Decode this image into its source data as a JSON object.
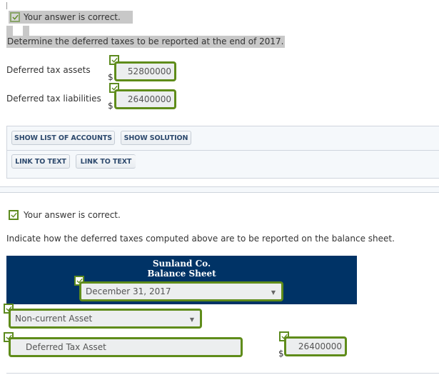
{
  "part1": {
    "correct_message": "Your answer is correct.",
    "question": "Determine the deferred taxes to be reported at the end of 2017.",
    "rows": [
      {
        "label": "Deferred tax assets",
        "currency": "$",
        "value": "52800000"
      },
      {
        "label": "Deferred tax liabilities",
        "currency": "$",
        "value": "26400000"
      }
    ],
    "buttons_row1": [
      "SHOW LIST OF ACCOUNTS",
      "SHOW SOLUTION"
    ],
    "buttons_row2": [
      "LINK TO TEXT",
      "LINK TO TEXT"
    ]
  },
  "part2": {
    "correct_message": "Your answer is correct.",
    "question": "Indicate how the deferred taxes computed above are to be reported on the balance sheet.",
    "balance_sheet": {
      "company": "Sunland Co.",
      "title": "Balance Sheet",
      "date_selected": "December 31, 2017",
      "section_selected": "Non-current Asset",
      "account": "Deferred Tax Asset",
      "currency": "$",
      "amount": "26400000"
    }
  },
  "colors": {
    "correct_green": "#5f8c1a",
    "header_navy": "#003366",
    "button_text": "#2e4a6e"
  }
}
